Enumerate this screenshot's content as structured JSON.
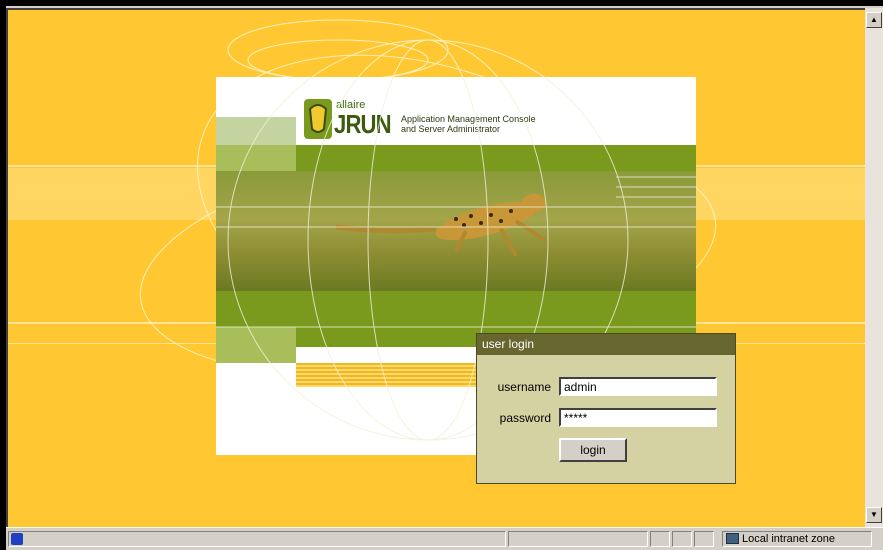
{
  "brand": {
    "vendor": "allaire",
    "product": "JRUN",
    "tagline_line1": "Application Management Console",
    "tagline_line2": "and Server Administrator"
  },
  "login": {
    "title": "user login",
    "username_label": "username",
    "username_value": "admin",
    "password_label": "password",
    "password_value": "*****",
    "submit_label": "login"
  },
  "statusbar": {
    "zone_text": "Local intranet zone",
    "page_icon": "ie-page-icon",
    "zone_icon": "intranet-zone-icon"
  },
  "colors": {
    "background": "#ffc832",
    "panel_green": "#7a9a1e",
    "login_bg": "#d4d2a2",
    "login_title_bg": "#66662e"
  }
}
